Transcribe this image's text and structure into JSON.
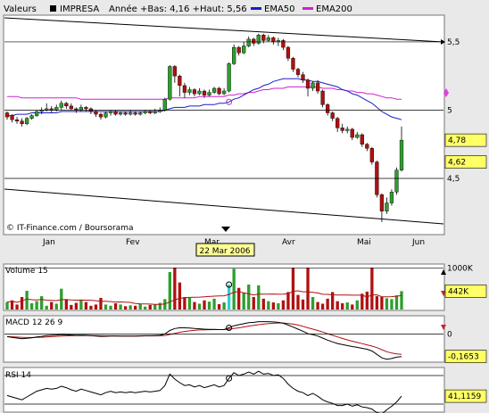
{
  "header": {
    "series_label": "Valeurs",
    "ticker": "IMPRESA",
    "range_text": "Année +Bas: 4,16 +Haut: 5,56",
    "legend": [
      {
        "name": "EMA50",
        "color": "#1c1cc8"
      },
      {
        "name": "EMA200",
        "color": "#d020d0"
      }
    ]
  },
  "source": "© IT-Finance.com / Boursorama",
  "cursor_date": "22 Mar 2006",
  "x_axis": {
    "labels": [
      "Jan",
      "Fev",
      "Mar",
      "Avr",
      "Mai",
      "Jun"
    ]
  },
  "chart_data": [
    {
      "type": "candlestick",
      "title": "IMPRESA",
      "ylim": [
        4.16,
        5.65
      ],
      "yticks": [
        {
          "v": 5.5,
          "label": "5,5"
        },
        {
          "v": 5.0,
          "label": "5"
        },
        {
          "v": 4.5,
          "label": "4,5"
        }
      ],
      "price_tags": [
        {
          "v": 4.78,
          "label": "4,78"
        },
        {
          "v": 4.62,
          "label": "4,62"
        }
      ],
      "up_color": "#2e9e2e",
      "down_color": "#b01010",
      "candles": [
        [
          4.98,
          4.95,
          4.99,
          4.93
        ],
        [
          4.96,
          4.93,
          4.97,
          4.91
        ],
        [
          4.93,
          4.92,
          4.95,
          4.9
        ],
        [
          4.92,
          4.9,
          4.94,
          4.88
        ],
        [
          4.9,
          4.94,
          4.95,
          4.89
        ],
        [
          4.94,
          4.96,
          4.97,
          4.93
        ],
        [
          4.96,
          4.99,
          5.0,
          4.95
        ],
        [
          4.99,
          5.0,
          5.02,
          4.97
        ],
        [
          5.0,
          5.01,
          5.05,
          4.99
        ],
        [
          5.01,
          5.0,
          5.03,
          4.98
        ],
        [
          5.0,
          5.02,
          5.04,
          4.99
        ],
        [
          5.02,
          5.05,
          5.07,
          5.0
        ],
        [
          5.05,
          5.03,
          5.06,
          5.01
        ],
        [
          5.03,
          5.01,
          5.05,
          5.0
        ],
        [
          5.01,
          5.0,
          5.02,
          4.98
        ],
        [
          5.0,
          5.02,
          5.04,
          4.99
        ],
        [
          5.02,
          5.01,
          5.03,
          4.99
        ],
        [
          5.01,
          4.99,
          5.02,
          4.97
        ],
        [
          4.99,
          4.97,
          5.0,
          4.95
        ],
        [
          4.97,
          4.95,
          4.98,
          4.93
        ],
        [
          4.95,
          4.98,
          4.99,
          4.94
        ],
        [
          4.98,
          4.99,
          5.0,
          4.96
        ],
        [
          4.99,
          4.97,
          5.0,
          4.96
        ],
        [
          4.97,
          4.98,
          4.99,
          4.96
        ],
        [
          4.98,
          4.97,
          4.99,
          4.96
        ],
        [
          4.97,
          4.98,
          5.0,
          4.96
        ],
        [
          4.98,
          4.97,
          4.99,
          4.96
        ],
        [
          4.97,
          4.98,
          4.99,
          4.96
        ],
        [
          4.98,
          4.99,
          5.0,
          4.97
        ],
        [
          4.99,
          4.98,
          5.0,
          4.97
        ],
        [
          4.98,
          4.99,
          5.01,
          4.97
        ],
        [
          4.99,
          5.0,
          5.02,
          4.98
        ],
        [
          5.0,
          5.08,
          5.09,
          4.99
        ],
        [
          5.08,
          5.32,
          5.33,
          5.07
        ],
        [
          5.32,
          5.25,
          5.33,
          5.2
        ],
        [
          5.25,
          5.18,
          5.26,
          5.1
        ],
        [
          5.18,
          5.13,
          5.2,
          5.09
        ],
        [
          5.13,
          5.15,
          5.17,
          5.11
        ],
        [
          5.15,
          5.12,
          5.16,
          5.1
        ],
        [
          5.12,
          5.14,
          5.16,
          5.11
        ],
        [
          5.14,
          5.11,
          5.15,
          5.09
        ],
        [
          5.11,
          5.13,
          5.15,
          5.1
        ],
        [
          5.13,
          5.16,
          5.17,
          5.12
        ],
        [
          5.16,
          5.12,
          5.17,
          5.11
        ],
        [
          5.12,
          5.14,
          5.16,
          5.11
        ],
        [
          5.14,
          5.34,
          5.35,
          5.13
        ],
        [
          5.34,
          5.46,
          5.48,
          5.33
        ],
        [
          5.46,
          5.42,
          5.47,
          5.4
        ],
        [
          5.42,
          5.47,
          5.5,
          5.41
        ],
        [
          5.47,
          5.52,
          5.54,
          5.46
        ],
        [
          5.52,
          5.49,
          5.53,
          5.47
        ],
        [
          5.49,
          5.55,
          5.56,
          5.48
        ],
        [
          5.55,
          5.51,
          5.56,
          5.49
        ],
        [
          5.51,
          5.53,
          5.55,
          5.5
        ],
        [
          5.53,
          5.5,
          5.54,
          5.48
        ],
        [
          5.5,
          5.51,
          5.53,
          5.47
        ],
        [
          5.51,
          5.46,
          5.52,
          5.44
        ],
        [
          5.46,
          5.38,
          5.47,
          5.36
        ],
        [
          5.38,
          5.3,
          5.39,
          5.28
        ],
        [
          5.3,
          5.26,
          5.31,
          5.24
        ],
        [
          5.26,
          5.22,
          5.28,
          5.2
        ],
        [
          5.22,
          5.16,
          5.23,
          5.1
        ],
        [
          5.16,
          5.2,
          5.21,
          5.14
        ],
        [
          5.2,
          5.14,
          5.22,
          5.12
        ],
        [
          5.14,
          5.04,
          5.15,
          5.02
        ],
        [
          5.04,
          4.98,
          5.05,
          4.96
        ],
        [
          4.98,
          4.94,
          4.99,
          4.92
        ],
        [
          4.94,
          4.87,
          4.95,
          4.84
        ],
        [
          4.87,
          4.85,
          4.9,
          4.83
        ],
        [
          4.85,
          4.86,
          4.88,
          4.83
        ],
        [
          4.86,
          4.8,
          4.87,
          4.78
        ],
        [
          4.8,
          4.82,
          4.84,
          4.79
        ],
        [
          4.82,
          4.75,
          4.83,
          4.73
        ],
        [
          4.75,
          4.72,
          4.76,
          4.7
        ],
        [
          4.72,
          4.62,
          4.73,
          4.6
        ],
        [
          4.62,
          4.38,
          4.63,
          4.36
        ],
        [
          4.38,
          4.26,
          4.39,
          4.18
        ],
        [
          4.26,
          4.32,
          4.36,
          4.24
        ],
        [
          4.32,
          4.4,
          4.42,
          4.3
        ],
        [
          4.4,
          4.56,
          4.58,
          4.38
        ],
        [
          4.56,
          4.78,
          4.88,
          4.55
        ]
      ],
      "ema50": [
        4.96,
        4.96,
        4.97,
        4.97,
        4.97,
        4.98,
        4.98,
        4.98,
        4.98,
        4.98,
        4.98,
        4.99,
        4.99,
        4.99,
        4.99,
        4.99,
        4.99,
        4.99,
        4.99,
        4.99,
        4.99,
        4.99,
        4.99,
        4.99,
        4.99,
        4.99,
        4.99,
        4.99,
        4.99,
        4.99,
        4.99,
        4.99,
        5.0,
        5.01,
        5.02,
        5.02,
        5.02,
        5.03,
        5.03,
        5.03,
        5.04,
        5.04,
        5.04,
        5.05,
        5.05,
        5.06,
        5.08,
        5.09,
        5.11,
        5.13,
        5.15,
        5.16,
        5.18,
        5.19,
        5.21,
        5.22,
        5.23,
        5.23,
        5.23,
        5.23,
        5.22,
        5.22,
        5.21,
        5.21,
        5.2,
        5.19,
        5.18,
        5.17,
        5.15,
        5.14,
        5.12,
        5.11,
        5.09,
        5.07,
        5.05,
        5.02,
        4.99,
        4.97,
        4.95,
        4.94,
        4.93
      ],
      "ema200": [
        5.1,
        5.1,
        5.1,
        5.09,
        5.09,
        5.09,
        5.09,
        5.09,
        5.09,
        5.09,
        5.09,
        5.09,
        5.09,
        5.09,
        5.09,
        5.08,
        5.08,
        5.08,
        5.08,
        5.08,
        5.08,
        5.08,
        5.08,
        5.08,
        5.08,
        5.08,
        5.08,
        5.08,
        5.08,
        5.08,
        5.08,
        5.08,
        5.08,
        5.09,
        5.09,
        5.09,
        5.09,
        5.09,
        5.09,
        5.1,
        5.1,
        5.1,
        5.1,
        5.1,
        5.1,
        5.11,
        5.11,
        5.12,
        5.12,
        5.13,
        5.13,
        5.14,
        5.15,
        5.15,
        5.16,
        5.16,
        5.16,
        5.17,
        5.17,
        5.17,
        5.17,
        5.17,
        5.17,
        5.17,
        5.16,
        5.16,
        5.16,
        5.15,
        5.15,
        5.14,
        5.14,
        5.13,
        5.13,
        5.12,
        5.12,
        5.11,
        5.1,
        5.09,
        5.09,
        5.08,
        5.08
      ]
    },
    {
      "type": "bar",
      "title": "Volume 15",
      "ylim": [
        0,
        1050
      ],
      "yticks": [
        {
          "v": 1000,
          "label": "1000K"
        }
      ],
      "price_tags": [
        {
          "v": 442,
          "label": "442K"
        }
      ],
      "highlight_color": "#30d0d0",
      "highlight_index": 45,
      "ma_color": "#b01010",
      "values": [
        180,
        220,
        120,
        300,
        450,
        150,
        200,
        320,
        90,
        180,
        140,
        500,
        250,
        110,
        160,
        230,
        180,
        90,
        120,
        280,
        120,
        90,
        150,
        120,
        80,
        100,
        90,
        130,
        70,
        110,
        120,
        160,
        250,
        900,
        1000,
        650,
        300,
        280,
        180,
        140,
        220,
        190,
        260,
        130,
        170,
        600,
        980,
        520,
        400,
        600,
        300,
        580,
        260,
        200,
        170,
        150,
        220,
        420,
        1000,
        350,
        240,
        1000,
        300,
        180,
        140,
        260,
        420,
        200,
        150,
        170,
        120,
        220,
        380,
        430,
        1000,
        320,
        300,
        270,
        250,
        340,
        442
      ]
    },
    {
      "type": "line",
      "title": "MACD 12 26 9",
      "ylim": [
        -0.2,
        0.12
      ],
      "yticks": [
        {
          "v": 0,
          "label": "0"
        }
      ],
      "price_tags": [
        {
          "v": -0.1653,
          "label": "-0,1653"
        }
      ],
      "macd": [
        -0.02,
        -0.025,
        -0.03,
        -0.035,
        -0.032,
        -0.028,
        -0.022,
        -0.018,
        -0.012,
        -0.01,
        -0.008,
        -0.005,
        -0.006,
        -0.008,
        -0.01,
        -0.009,
        -0.01,
        -0.012,
        -0.015,
        -0.018,
        -0.017,
        -0.015,
        -0.016,
        -0.015,
        -0.016,
        -0.015,
        -0.015,
        -0.014,
        -0.013,
        -0.013,
        -0.012,
        -0.01,
        0.0,
        0.025,
        0.04,
        0.045,
        0.045,
        0.043,
        0.04,
        0.038,
        0.035,
        0.034,
        0.034,
        0.032,
        0.032,
        0.045,
        0.06,
        0.068,
        0.075,
        0.082,
        0.085,
        0.09,
        0.09,
        0.09,
        0.088,
        0.085,
        0.078,
        0.065,
        0.05,
        0.035,
        0.02,
        0.002,
        -0.005,
        -0.015,
        -0.03,
        -0.045,
        -0.058,
        -0.07,
        -0.078,
        -0.085,
        -0.092,
        -0.098,
        -0.105,
        -0.112,
        -0.125,
        -0.15,
        -0.175,
        -0.185,
        -0.18,
        -0.17,
        -0.1653
      ],
      "signal": [
        -0.02,
        -0.021,
        -0.023,
        -0.025,
        -0.026,
        -0.026,
        -0.025,
        -0.024,
        -0.022,
        -0.02,
        -0.018,
        -0.016,
        -0.014,
        -0.013,
        -0.012,
        -0.012,
        -0.011,
        -0.012,
        -0.012,
        -0.013,
        -0.014,
        -0.014,
        -0.014,
        -0.015,
        -0.015,
        -0.015,
        -0.015,
        -0.015,
        -0.014,
        -0.014,
        -0.014,
        -0.013,
        -0.011,
        -0.004,
        0.004,
        0.012,
        0.018,
        0.023,
        0.026,
        0.029,
        0.03,
        0.031,
        0.032,
        0.032,
        0.032,
        0.035,
        0.04,
        0.045,
        0.051,
        0.057,
        0.063,
        0.068,
        0.072,
        0.076,
        0.078,
        0.08,
        0.08,
        0.077,
        0.072,
        0.065,
        0.056,
        0.045,
        0.035,
        0.025,
        0.014,
        0.002,
        -0.01,
        -0.022,
        -0.033,
        -0.043,
        -0.053,
        -0.062,
        -0.071,
        -0.08,
        -0.089,
        -0.1,
        -0.115,
        -0.13,
        -0.14,
        -0.146,
        -0.15
      ]
    },
    {
      "type": "line",
      "title": "RSI 14",
      "ylim": [
        20,
        80
      ],
      "yticks": [],
      "price_tags": [
        {
          "v": 41.1159,
          "label": "41,1159"
        }
      ],
      "values": [
        42,
        40,
        38,
        36,
        40,
        44,
        48,
        50,
        52,
        51,
        52,
        55,
        53,
        50,
        48,
        51,
        49,
        47,
        45,
        43,
        46,
        48,
        46,
        47,
        46,
        47,
        46,
        47,
        48,
        47,
        48,
        49,
        56,
        72,
        65,
        60,
        56,
        57,
        54,
        56,
        53,
        55,
        57,
        54,
        56,
        66,
        74,
        70,
        72,
        75,
        72,
        76,
        72,
        73,
        70,
        71,
        66,
        58,
        52,
        48,
        46,
        42,
        45,
        41,
        36,
        33,
        31,
        28,
        28,
        30,
        27,
        29,
        26,
        25,
        23,
        18,
        16,
        22,
        27,
        33,
        41.1159
      ]
    }
  ]
}
